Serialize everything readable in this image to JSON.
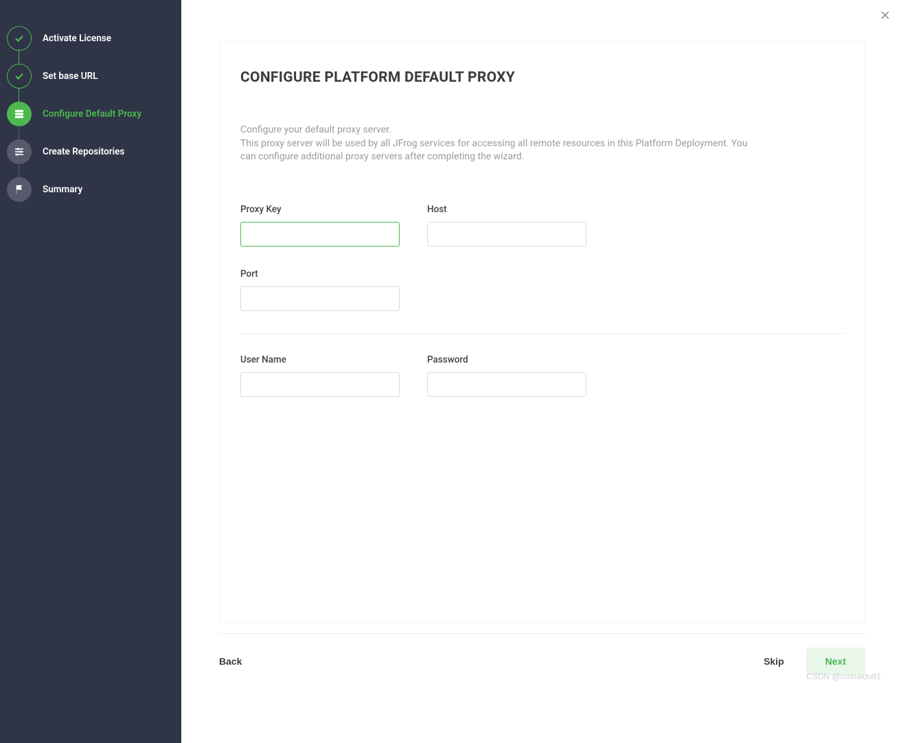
{
  "sidebar": {
    "steps": [
      {
        "label": "Activate License",
        "state": "done",
        "icon": "check-icon"
      },
      {
        "label": "Set base URL",
        "state": "done",
        "icon": "check-icon"
      },
      {
        "label": "Configure Default Proxy",
        "state": "active",
        "icon": "server-icon"
      },
      {
        "label": "Create Repositories",
        "state": "pending",
        "icon": "sliders-icon"
      },
      {
        "label": "Summary",
        "state": "pending",
        "icon": "flag-icon"
      }
    ]
  },
  "main": {
    "title": "CONFIGURE PLATFORM DEFAULT PROXY",
    "description_line1": "Configure your default proxy server.",
    "description_line2": "This proxy server will be used by all JFrog services for accessing all remote resources in this Platform Deployment. You can configure additional proxy servers after completing the wizard.",
    "form": {
      "proxy_key": {
        "label": "Proxy Key",
        "value": ""
      },
      "host": {
        "label": "Host",
        "value": ""
      },
      "port": {
        "label": "Port",
        "value": ""
      },
      "username": {
        "label": "User Name",
        "value": ""
      },
      "password": {
        "label": "Password",
        "value": ""
      }
    }
  },
  "footer": {
    "back_label": "Back",
    "skip_label": "Skip",
    "next_label": "Next"
  },
  "watermark": "CSDN @cronaldo91"
}
